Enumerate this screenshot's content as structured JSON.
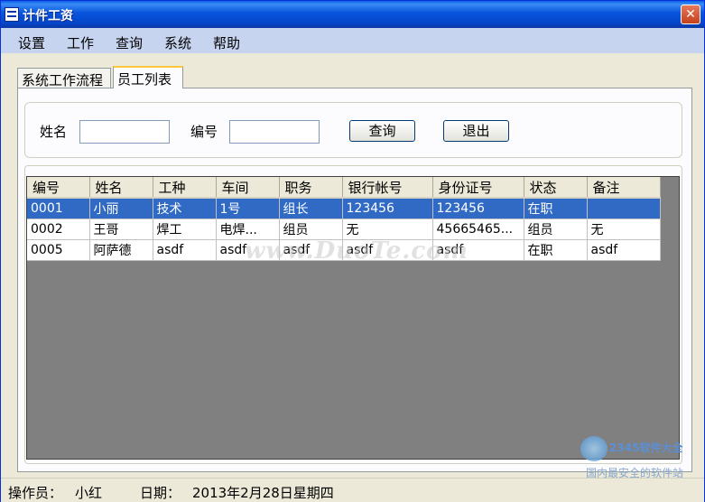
{
  "window": {
    "title": "计件工资",
    "close_symbol": "✕"
  },
  "menu": [
    "设置",
    "工作",
    "查询",
    "系统",
    "帮助"
  ],
  "tabs": [
    "系统工作流程",
    "员工列表"
  ],
  "search": {
    "name_label": "姓名",
    "name_value": "",
    "number_label": "编号",
    "number_value": "",
    "query_button": "查询",
    "exit_button": "退出"
  },
  "table": {
    "columns": [
      "编号",
      "姓名",
      "工种",
      "车间",
      "职务",
      "银行帐号",
      "身份证号",
      "状态",
      "备注"
    ],
    "rows": [
      [
        "0001",
        "小丽",
        "技术",
        "1号",
        "组长",
        "123456",
        "123456",
        "在职",
        ""
      ],
      [
        "0002",
        "王哥",
        "焊工",
        "电焊...",
        "组员",
        "无",
        "45665465...",
        "组员",
        "无"
      ],
      [
        "0005",
        "阿萨德",
        "asdf",
        "asdf",
        "asdf",
        "asdf",
        "asdf",
        "在职",
        "asdf"
      ]
    ],
    "selected_row": 0
  },
  "status": {
    "operator_label": "操作员：",
    "operator_value": "小红",
    "date_label": "日期：",
    "date_value": "2013年2月28日星期四"
  },
  "overlay": {
    "watermark": "www.DuoTe.com",
    "logo_text": "2345软件大全",
    "logo_sub": "国内最安全的软件站"
  },
  "colors": {
    "titlebar": "#0855dd",
    "menubar": "#c7d4ef",
    "selection": "#316ac5",
    "grid_background": "#808080"
  }
}
